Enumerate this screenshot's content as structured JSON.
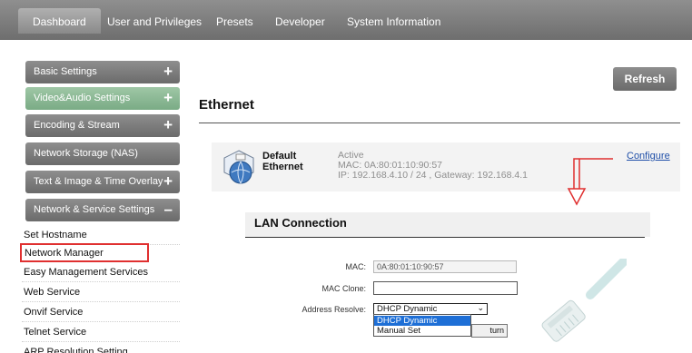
{
  "nav": {
    "tabs": [
      {
        "label": "Dashboard"
      },
      {
        "label": "User and Privileges"
      },
      {
        "label": "Presets"
      },
      {
        "label": "Developer"
      },
      {
        "label": "System Information"
      }
    ]
  },
  "sidebar": {
    "menus": [
      {
        "label": "Basic Settings",
        "toggle": "+"
      },
      {
        "label": "Video&Audio Settings",
        "toggle": "+"
      },
      {
        "label": "Encoding & Stream",
        "toggle": "+"
      },
      {
        "label": "Network Storage (NAS)",
        "toggle": ""
      },
      {
        "label": "Text & Image & Time Overlay",
        "toggle": "+"
      },
      {
        "label": "Network & Service Settings",
        "toggle": "–"
      }
    ],
    "submenu": [
      {
        "label": "Set Hostname"
      },
      {
        "label": "Network Manager"
      },
      {
        "label": "Easy Management Services"
      },
      {
        "label": "Web Service"
      },
      {
        "label": "Onvif Service"
      },
      {
        "label": "Telnet Service"
      },
      {
        "label": "ARP Resolution Setting"
      }
    ]
  },
  "main": {
    "refresh_label": "Refresh",
    "section_title": "Ethernet",
    "interface": {
      "name_line1": "Default",
      "name_line2": "Ethernet",
      "status": "Active",
      "mac_line": "MAC: 0A:80:01:10:90:57",
      "ip_line": "IP: 192.168.4.10 / 24 , Gateway: 192.168.4.1",
      "configure_label": "Configure"
    },
    "lan": {
      "title": "LAN Connection",
      "mac_label": "MAC:",
      "mac_value": "0A:80:01:10:90:57",
      "clone_label": "MAC Clone:",
      "clone_value": "",
      "resolve_label": "Address Resolve:",
      "resolve_selected": "DHCP Dynamic",
      "resolve_options": [
        "DHCP Dynamic",
        "Manual Set"
      ],
      "return_label": "turn"
    }
  },
  "colors": {
    "highlight_box": "#e03030",
    "arrow": "#e03030",
    "link": "#1f4fa8",
    "selected_option": "#1e6fd6"
  }
}
